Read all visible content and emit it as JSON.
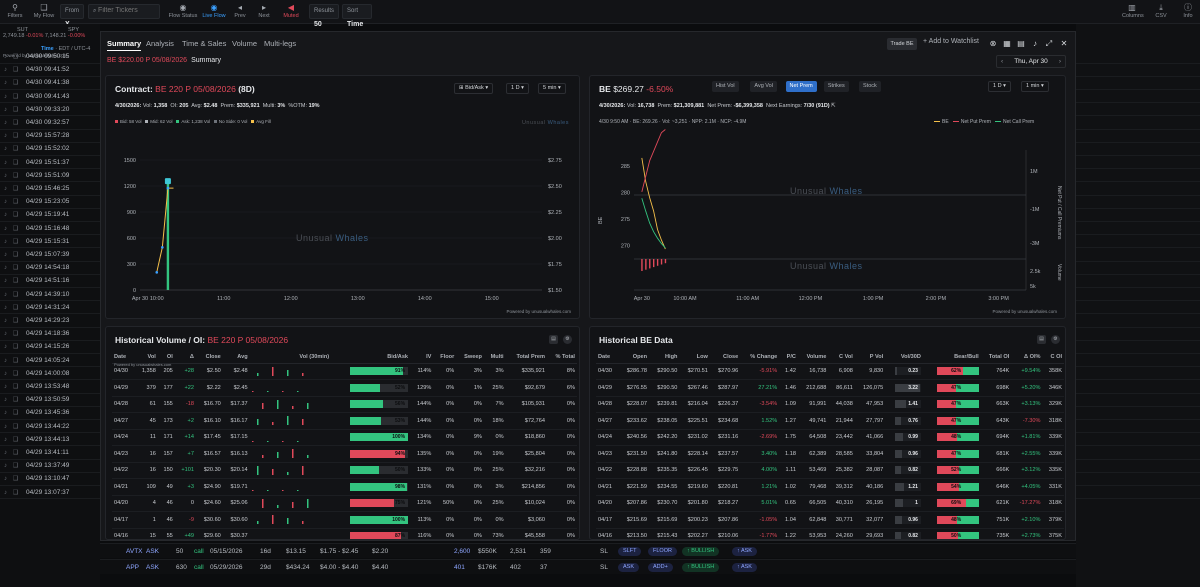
{
  "topbar": {
    "filters_label": "Filters",
    "myflow_label": "My Flow",
    "from_label": "From",
    "from_value": "X",
    "filter_placeholder": "Filter Tickers",
    "flow_status_label": "Flow Status",
    "flow_status_value": "Live Flow",
    "prev_label": "Prev",
    "next_label": "Next",
    "muted_label": "Muted",
    "results_label": "Results",
    "results_value": "50",
    "sort_label": "Sort",
    "sort_value": "Time",
    "columns_label": "Columns",
    "csv_label": "CSV",
    "info_label": "Info"
  },
  "indices": [
    {
      "name": "SUT",
      "value": "2,749.18",
      "change": "-0.01%"
    },
    {
      "name": "SPY",
      "value": "7,148.21",
      "change": "-0.00%"
    }
  ],
  "left_header": {
    "label": "Time",
    "tz": "· EDT / UTC-4",
    "powered": "Powered by unusualwhales.com"
  },
  "flow_rows": [
    "04/30 09:50:15",
    "04/30 09:41:52",
    "04/30 09:41:38",
    "04/30 09:41:43",
    "04/30 09:33:20",
    "04/30 09:32:57",
    "04/29 15:57:28",
    "04/29 15:52:02",
    "04/29 15:51:37",
    "04/29 15:51:09",
    "04/29 15:46:25",
    "04/29 15:23:05",
    "04/29 15:19:41",
    "04/29 15:16:48",
    "04/29 15:15:31",
    "04/29 15:07:39",
    "04/29 14:54:18",
    "04/29 14:51:16",
    "04/29 14:39:10",
    "04/29 14:31:24",
    "04/29 14:29:23",
    "04/29 14:18:36",
    "04/29 14:15:26",
    "04/29 14:05:24",
    "04/29 14:00:08",
    "04/29 13:53:48",
    "04/29 13:50:59",
    "04/29 13:45:36",
    "04/29 13:44:22",
    "04/29 13:44:13",
    "04/29 13:41:11",
    "04/29 13:37:49",
    "04/29 13:10:47",
    "04/29 13:07:37"
  ],
  "bottom_rows": [
    {
      "ticker": "AVTX",
      "side": "ASK",
      "size": "50",
      "type": "call",
      "expiry": "05/15/2026",
      "dte": "16d",
      "spot": "$13.15",
      "price": "$1.75 - $2.45",
      "prem_each": "$2.20",
      "vol": "2,600",
      "prem": "$550K",
      "oi": "2,531",
      "oi2": "359",
      "exec": "SL",
      "tag1": "SLFT",
      "tag2": "FLOOR",
      "sent": "↑ BULLISH",
      "aside": "↑ ASK"
    },
    {
      "ticker": "APP",
      "side": "ASK",
      "size": "630",
      "type": "call",
      "expiry": "05/29/2026",
      "dte": "29d",
      "spot": "$434.24",
      "price": "$4.00 - $4.40",
      "prem_each": "$4.40",
      "vol": "401",
      "prem": "$176K",
      "oi": "402",
      "oi2": "37",
      "exec": "SL",
      "tag1": "ASK",
      "tag2": "ADD+",
      "sent": "↑ BULLISH",
      "aside": "↑ ASK"
    }
  ],
  "modal": {
    "tabs": [
      "Summary",
      "Analysis",
      "Time & Sales",
      "Volume",
      "Multi-legs"
    ],
    "trade_label": "Trade BE",
    "watchlist_label": "+ Add to Watchlist",
    "subtitle_contract": "BE $220.00 P 05/08/2026",
    "subtitle_page": "Summary",
    "date_label": "Thu, Apr 30"
  },
  "contract_panel": {
    "title_prefix": "Contract:",
    "title_contract": "BE 220 P 05/08/2026",
    "title_dte": "(8D)",
    "price_mode": "Bid/Ask",
    "range": "1 D",
    "interval": "5 min",
    "stats": {
      "date": "4/30/2026:",
      "vol_label": "Vol:",
      "vol": "1,358",
      "oi_label": "OI:",
      "oi": "205",
      "avg_label": "Avg:",
      "avg": "$2.48",
      "prem_label": "Prem:",
      "prem": "$335,921",
      "multi_label": "Multi:",
      "multi": "3%",
      "otm_label": "%OTM:",
      "otm": "19%"
    },
    "legend": {
      "bid": "Bid: 58 Vol",
      "mid": "Mid: 62 Vol",
      "ask": "Ask: 1,238 Vol",
      "noside": "No Side: 0 Vol",
      "avgfill": "Avg Fill"
    },
    "watermark_a": "Unusual",
    "watermark_b": "Whales",
    "powered": "Powered by unusualwhales.com"
  },
  "stock_panel": {
    "ticker": "BE",
    "price": "$269.27",
    "change": "-6.50%",
    "tabs": [
      "Hist Vol",
      "Avg Vol",
      "Net Prem",
      "Strikes",
      "Stock"
    ],
    "range": "1 D",
    "interval": "1 min",
    "stats": {
      "date": "4/30/2026:",
      "vol_label": "Vol:",
      "vol": "16,738",
      "prem_label": "Prem:",
      "prem": "$21,309,881",
      "netprem_label": "Net Prem:",
      "netprem": "-$6,399,358",
      "earn_label": "Next Earnings:",
      "earn": "7/30 (91D)"
    },
    "legend_info": "4/30 9:50 AM · BE: 269.26 · Vol: ~3,251 · NPP: 2.1M · NCP: -4.9M",
    "legend": {
      "be": "BE",
      "npp": "Net Put Prem",
      "ncp": "Net Call Prem"
    },
    "powered": "Powered by unusualwhales.com"
  },
  "hist_panel": {
    "title_prefix": "Historical Volume / OI:",
    "title_contract": "BE 220 P 05/08/2026",
    "columns": [
      "Date",
      "Vol",
      "OI",
      "Δ",
      "Close",
      "Avg",
      "Vol (30min)",
      "Bid/Ask",
      "IV",
      "Floor",
      "Sweep",
      "Multi",
      "Total Prem",
      "% Total"
    ],
    "powered": "Powered by unusualwhales.com",
    "rows": [
      {
        "date": "04/30",
        "vol": "1,358",
        "oi": "205",
        "d": "+28",
        "close": "$2.50",
        "avg": "$2.48",
        "ba": 91,
        "iv": "114%",
        "floor": "0%",
        "sweep": "3%",
        "multi": "3%",
        "prem": "$335,921",
        "pct": "8%"
      },
      {
        "date": "04/29",
        "vol": "379",
        "oi": "177",
        "d": "+22",
        "close": "$2.22",
        "avg": "$2.45",
        "ba": 52,
        "iv": "129%",
        "floor": "0%",
        "sweep": "1%",
        "multi": "25%",
        "prem": "$92,679",
        "pct": "6%"
      },
      {
        "date": "04/28",
        "vol": "61",
        "oi": "155",
        "d": "-18",
        "close": "$16.70",
        "avg": "$17.37",
        "ba": 56,
        "iv": "144%",
        "floor": "0%",
        "sweep": "0%",
        "multi": "7%",
        "prem": "$105,931",
        "pct": "0%"
      },
      {
        "date": "04/27",
        "vol": "45",
        "oi": "173",
        "d": "+2",
        "close": "$16.10",
        "avg": "$16.17",
        "ba": 53,
        "iv": "144%",
        "floor": "0%",
        "sweep": "0%",
        "multi": "18%",
        "prem": "$72,764",
        "pct": "0%"
      },
      {
        "date": "04/24",
        "vol": "11",
        "oi": "171",
        "d": "+14",
        "close": "$17.45",
        "avg": "$17.15",
        "ba": 100,
        "iv": "134%",
        "floor": "0%",
        "sweep": "9%",
        "multi": "0%",
        "prem": "$18,860",
        "pct": "0%"
      },
      {
        "date": "04/23",
        "vol": "16",
        "oi": "157",
        "d": "+7",
        "close": "$16.57",
        "avg": "$16.13",
        "ba": 94,
        "iv": "135%",
        "floor": "0%",
        "sweep": "0%",
        "multi": "19%",
        "prem": "$25,804",
        "pct": "0%"
      },
      {
        "date": "04/22",
        "vol": "16",
        "oi": "150",
        "d": "+101",
        "close": "$20.30",
        "avg": "$20.14",
        "ba": 50,
        "iv": "133%",
        "floor": "0%",
        "sweep": "0%",
        "multi": "25%",
        "prem": "$32,216",
        "pct": "0%"
      },
      {
        "date": "04/21",
        "vol": "109",
        "oi": "49",
        "d": "+3",
        "close": "$24.90",
        "avg": "$19.71",
        "ba": 98,
        "iv": "131%",
        "floor": "0%",
        "sweep": "0%",
        "multi": "3%",
        "prem": "$214,856",
        "pct": "0%"
      },
      {
        "date": "04/20",
        "vol": "4",
        "oi": "46",
        "d": "0",
        "close": "$24.60",
        "avg": "$25.06",
        "ba": 75,
        "iv": "121%",
        "floor": "50%",
        "sweep": "0%",
        "multi": "25%",
        "prem": "$10,024",
        "pct": "0%"
      },
      {
        "date": "04/17",
        "vol": "1",
        "oi": "46",
        "d": "-9",
        "close": "$30.60",
        "avg": "$30.60",
        "ba": 100,
        "iv": "113%",
        "floor": "0%",
        "sweep": "0%",
        "multi": "0%",
        "prem": "$3,060",
        "pct": "0%"
      },
      {
        "date": "04/16",
        "vol": "15",
        "oi": "55",
        "d": "+49",
        "close": "$29.60",
        "avg": "$30.37",
        "ba": 87,
        "iv": "116%",
        "floor": "0%",
        "sweep": "0%",
        "multi": "73%",
        "prem": "$45,558",
        "pct": "0%"
      }
    ]
  },
  "be_panel": {
    "title": "Historical BE Data",
    "columns": [
      "Date",
      "Open",
      "High",
      "Low",
      "Close",
      "% Change",
      "P/C",
      "Volume",
      "C Vol",
      "P Vol",
      "Vol/30D",
      "Bear/Bull",
      "Total OI",
      "Δ OI%",
      "C OI"
    ],
    "rows": [
      {
        "date": "04/30",
        "open": "$286.78",
        "high": "$290.50",
        "low": "$270.51",
        "close": "$270.96",
        "chg": "-5.91%",
        "pc": "1.42",
        "volume": "16,738",
        "cvol": "6,908",
        "pvol": "9,830",
        "v30": "0.23",
        "bb": 62,
        "toi": "764K",
        "doi": "+9.54%",
        "coi": "358K"
      },
      {
        "date": "04/29",
        "open": "$276.55",
        "high": "$290.50",
        "low": "$267.46",
        "close": "$287.97",
        "chg": "27.21%",
        "pc": "1.46",
        "volume": "212,688",
        "cvol": "86,611",
        "pvol": "126,075",
        "v30": "3.22",
        "bb": 47,
        "toi": "698K",
        "doi": "+5.20%",
        "coi": "346K"
      },
      {
        "date": "04/28",
        "open": "$228.07",
        "high": "$239.81",
        "low": "$216.04",
        "close": "$226.37",
        "chg": "-3.54%",
        "pc": "1.09",
        "volume": "91,991",
        "cvol": "44,038",
        "pvol": "47,953",
        "v30": "1.41",
        "bb": 47,
        "toi": "663K",
        "doi": "+3.13%",
        "coi": "329K"
      },
      {
        "date": "04/27",
        "open": "$233.62",
        "high": "$238.05",
        "low": "$225.51",
        "close": "$234.68",
        "chg": "1.52%",
        "pc": "1.27",
        "volume": "49,741",
        "cvol": "21,944",
        "pvol": "27,797",
        "v30": "0.76",
        "bb": 47,
        "toi": "643K",
        "doi": "-7.30%",
        "coi": "318K"
      },
      {
        "date": "04/24",
        "open": "$240.56",
        "high": "$242.20",
        "low": "$231.02",
        "close": "$231.16",
        "chg": "-2.69%",
        "pc": "1.75",
        "volume": "64,508",
        "cvol": "23,442",
        "pvol": "41,066",
        "v30": "0.99",
        "bb": 48,
        "toi": "694K",
        "doi": "+1.81%",
        "coi": "339K"
      },
      {
        "date": "04/23",
        "open": "$231.50",
        "high": "$241.80",
        "low": "$228.14",
        "close": "$237.57",
        "chg": "3.40%",
        "pc": "1.18",
        "volume": "62,389",
        "cvol": "28,585",
        "pvol": "33,804",
        "v30": "0.96",
        "bb": 47,
        "toi": "681K",
        "doi": "+2.55%",
        "coi": "339K"
      },
      {
        "date": "04/22",
        "open": "$228.88",
        "high": "$235.35",
        "low": "$226.45",
        "close": "$229.75",
        "chg": "4.00%",
        "pc": "1.11",
        "volume": "53,469",
        "cvol": "25,382",
        "pvol": "28,087",
        "v30": "0.82",
        "bb": 52,
        "toi": "666K",
        "doi": "+3.12%",
        "coi": "335K"
      },
      {
        "date": "04/21",
        "open": "$221.59",
        "high": "$234.55",
        "low": "$219.60",
        "close": "$220.81",
        "chg": "1.21%",
        "pc": "1.02",
        "volume": "79,468",
        "cvol": "39,312",
        "pvol": "40,186",
        "v30": "1.21",
        "bb": 54,
        "toi": "646K",
        "doi": "+4.05%",
        "coi": "331K"
      },
      {
        "date": "04/20",
        "open": "$207.86",
        "high": "$230.70",
        "low": "$201.80",
        "close": "$218.27",
        "chg": "5.01%",
        "pc": "0.65",
        "volume": "66,505",
        "cvol": "40,310",
        "pvol": "26,195",
        "v30": "1",
        "bb": 69,
        "toi": "621K",
        "doi": "-17.27%",
        "coi": "318K"
      },
      {
        "date": "04/17",
        "open": "$215.69",
        "high": "$215.69",
        "low": "$200.23",
        "close": "$207.86",
        "chg": "-1.05%",
        "pc": "1.04",
        "volume": "62,848",
        "cvol": "30,771",
        "pvol": "32,077",
        "v30": "0.96",
        "bb": 48,
        "toi": "751K",
        "doi": "+2.10%",
        "coi": "379K"
      },
      {
        "date": "04/16",
        "open": "$213.50",
        "high": "$215.43",
        "low": "$202.27",
        "close": "$210.06",
        "chg": "-1.77%",
        "pc": "1.22",
        "volume": "53,953",
        "cvol": "24,260",
        "pvol": "29,693",
        "v30": "0.82",
        "bb": 50,
        "toi": "735K",
        "doi": "+2.73%",
        "coi": "375K"
      }
    ]
  },
  "chart_data": [
    {
      "type": "line",
      "title": "Contract: BE 220 P 05/08/2026 (8D)",
      "x_tick_labels": [
        "Apr 30",
        "10:00",
        "11:00",
        "12:00",
        "13:00",
        "14:00",
        "15:00"
      ],
      "y_left_ticks": [
        0,
        300,
        600,
        900,
        1200,
        1500
      ],
      "y_right_ticks": [
        "$1.50",
        "$1.75",
        "$2.00",
        "$2.25",
        "$2.50",
        "$2.75"
      ],
      "ylim_left": [
        0,
        1500
      ],
      "ylim_right": [
        1.5,
        2.75
      ],
      "x_minutes": [
        15,
        20,
        25,
        30
      ],
      "series": [
        {
          "name": "Ask",
          "values": [
            0,
            0,
            1238,
            1238
          ]
        },
        {
          "name": "Avg Fill",
          "values": [
            1.67,
            1.91,
            2.48,
            2.48
          ]
        }
      ]
    },
    {
      "type": "line",
      "x_tick_labels": [
        "Apr 30",
        "10:00 AM",
        "11:00 AM",
        "12:00 PM",
        "1:00 PM",
        "2:00 PM",
        "3:00 PM"
      ],
      "ylabel_left": "BE",
      "ylabel_right": "Net Put / Call Premiums",
      "ylabel_right2": "Volume",
      "y_left_ticks": [
        270,
        275,
        280,
        285
      ],
      "y_right_ticks": [
        "1M",
        "-1M",
        "-3M"
      ],
      "y_volume_ticks": [
        "2.5k",
        "5k"
      ],
      "series": [
        {
          "name": "BE",
          "values": [
            286.5,
            282.0,
            279.0,
            276.5,
            273.0,
            271.0,
            269.3
          ]
        },
        {
          "name": "Net Put Prem",
          "values": [
            0.1,
            0.6,
            1.1,
            1.4,
            1.7,
            2.0,
            2.1
          ]
        },
        {
          "name": "Net Call Prem",
          "values": [
            -0.3,
            -1.5,
            -2.6,
            -3.4,
            -4.0,
            -4.5,
            -4.9
          ]
        }
      ]
    }
  ]
}
